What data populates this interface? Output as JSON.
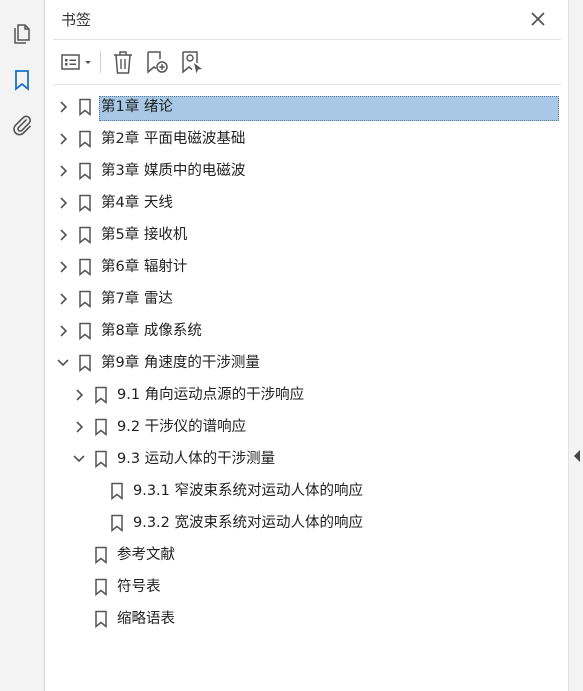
{
  "leftbar": {
    "icons": [
      "pages-icon",
      "bookmark-icon",
      "attachment-icon"
    ]
  },
  "panel": {
    "title": "书签"
  },
  "toolbar": {
    "icons": [
      "options-menu-icon",
      "delete-icon",
      "new-bookmark-icon",
      "bookmark-from-selection-icon"
    ]
  },
  "bookmarks": [
    {
      "label": "第1章 绪论",
      "level": 0,
      "toggle": "collapsed",
      "selected": true
    },
    {
      "label": "第2章 平面电磁波基础",
      "level": 0,
      "toggle": "collapsed"
    },
    {
      "label": "第3章 媒质中的电磁波",
      "level": 0,
      "toggle": "collapsed"
    },
    {
      "label": "第4章 天线",
      "level": 0,
      "toggle": "collapsed"
    },
    {
      "label": "第5章 接收机",
      "level": 0,
      "toggle": "collapsed"
    },
    {
      "label": "第6章 辐射计",
      "level": 0,
      "toggle": "collapsed"
    },
    {
      "label": "第7章 雷达",
      "level": 0,
      "toggle": "collapsed"
    },
    {
      "label": "第8章 成像系统",
      "level": 0,
      "toggle": "collapsed"
    },
    {
      "label": "第9章 角速度的干涉测量",
      "level": 0,
      "toggle": "expanded"
    },
    {
      "label": "9.1 角向运动点源的干涉响应",
      "level": 1,
      "toggle": "collapsed"
    },
    {
      "label": "9.2 干涉仪的谱响应",
      "level": 1,
      "toggle": "collapsed"
    },
    {
      "label": "9.3 运动人体的干涉测量",
      "level": 1,
      "toggle": "expanded"
    },
    {
      "label": "9.3.1 窄波束系统对运动人体的响应",
      "level": 2,
      "toggle": "none"
    },
    {
      "label": "9.3.2 宽波束系统对运动人体的响应",
      "level": 2,
      "toggle": "none"
    },
    {
      "label": "参考文献",
      "level": 1,
      "toggle": "none"
    },
    {
      "label": "符号表",
      "level": 1,
      "toggle": "none"
    },
    {
      "label": "缩略语表",
      "level": 1,
      "toggle": "none"
    }
  ],
  "colors": {
    "accent": "#1a73c9",
    "selection": "#a8c8e6",
    "icon": "#555555"
  }
}
